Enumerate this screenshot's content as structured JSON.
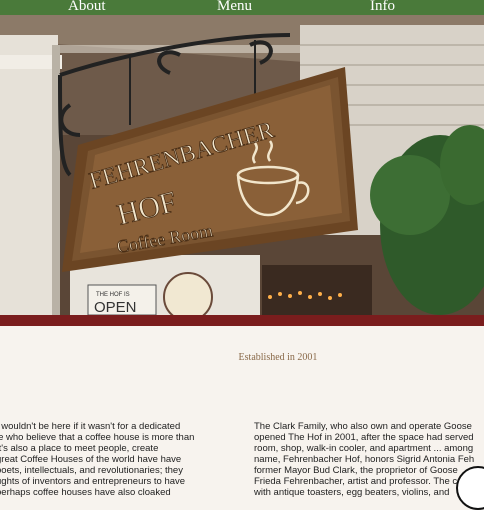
{
  "nav": {
    "about": "About",
    "menu": "Menu",
    "info": "Info"
  },
  "sign": {
    "line1": "FEHRENBACHER",
    "line2": "HOF",
    "line3": "Coffee Room"
  },
  "small_signs": {
    "open_sign": "OPEN",
    "open_sign_top": "THE HOF IS"
  },
  "established": "Established in 2001",
  "columns": {
    "left": "t wouldn't be here if it wasn't for a dedicated\nle who believe that a coffee house is more than\n It's also a place to meet people, create\n great Coffee Houses of the world have have\n poets, intellectuals, and revolutionaries; they\n ughts of inventors and entrepreneurs to have\n perhaps coffee houses have also cloaked",
    "right": "The Clark Family, who also own and operate Goose\nopened The Hof in 2001, after the space had served\nroom, shop, walk-in cooler, and apartment ... among\nname, Fehrenbacher Hof, honors Sigrid Antonia Feh\nformer Mayor Bud Clark, the proprietor of Goose\nFrieda Fehrenbacher, artist and professor. The coffe\nwith antique toasters, egg beaters, violins, and"
  },
  "colors": {
    "nav_bg": "#4a7a3a",
    "accent_bar": "#7a1d1d",
    "page_bg": "#f7f3ee",
    "established_text": "#8a6a4a"
  },
  "icons": {
    "chat": "chat-bubble-icon"
  }
}
